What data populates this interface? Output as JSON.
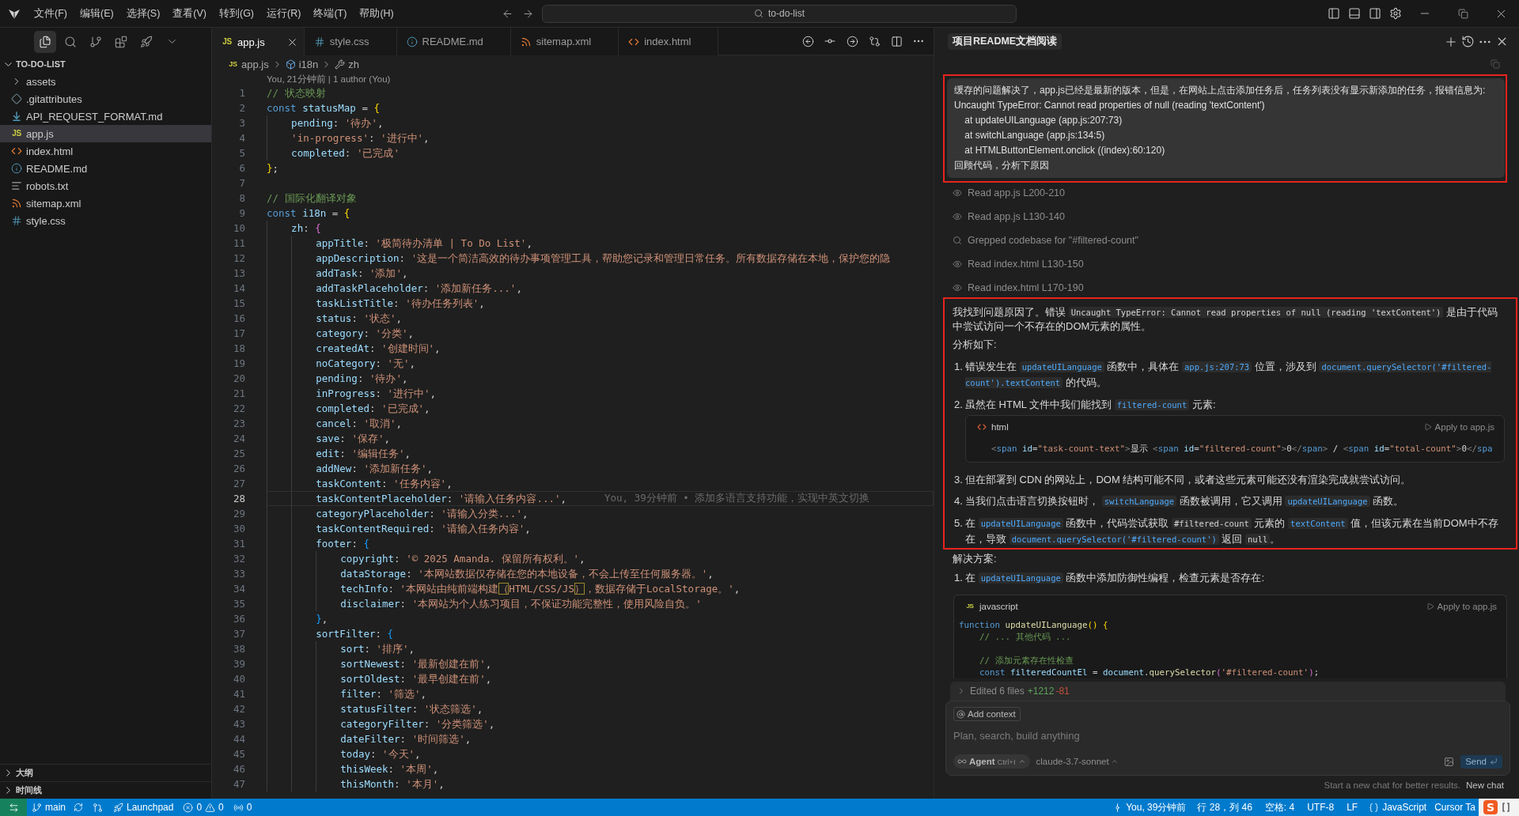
{
  "title_bar": {
    "menus": [
      "文件(F)",
      "编辑(E)",
      "选择(S)",
      "查看(V)",
      "转到(G)",
      "运行(R)",
      "终端(T)",
      "帮助(H)"
    ],
    "search": "to-do-list"
  },
  "sidebar": {
    "toolbar": [
      {
        "selected": true
      },
      {
        "selected": false
      },
      {
        "selected": false
      },
      {
        "selected": false
      },
      {
        "selected": false
      }
    ],
    "explorer": {
      "title": "TO-DO-LIST",
      "expanded": true,
      "items": [
        {
          "name": "assets",
          "kind": "folder",
          "expanded": false,
          "selected": false
        },
        {
          "name": ".gitattributes",
          "kind": "gitattributes",
          "selected": false
        },
        {
          "name": "API_REQUEST_FORMAT.md",
          "kind": "markdown",
          "selected": false
        },
        {
          "name": "app.js",
          "kind": "javascript",
          "icon_label": "JS",
          "selected": true
        },
        {
          "name": "index.html",
          "kind": "html",
          "selected": false
        },
        {
          "name": "README.md",
          "kind": "readme",
          "selected": false
        },
        {
          "name": "robots.txt",
          "kind": "text",
          "selected": false
        },
        {
          "name": "sitemap.xml",
          "kind": "xml",
          "selected": false
        },
        {
          "name": "style.css",
          "kind": "css",
          "selected": false
        }
      ]
    },
    "sections": [
      {
        "title": "大纲",
        "expanded": false
      },
      {
        "title": "时间线",
        "expanded": false
      }
    ]
  },
  "editor": {
    "tabs": [
      {
        "label": "app.js",
        "kind": "javascript",
        "icon_label": "JS",
        "selected": true
      },
      {
        "label": "style.css",
        "kind": "css",
        "selected": false
      },
      {
        "label": "README.md",
        "kind": "readme",
        "selected": false
      },
      {
        "label": "sitemap.xml",
        "kind": "xml",
        "selected": false
      },
      {
        "label": "index.html",
        "kind": "html",
        "selected": false
      }
    ],
    "breadcrumbs": [
      {
        "label": "app.js",
        "kind": "javascript",
        "icon_label": "JS"
      },
      {
        "label": "i18n",
        "kind": "variable"
      },
      {
        "label": "zh",
        "kind": "property"
      }
    ],
    "codelens": "You, 21分钟前 | 1 author (You)",
    "lines": [
      {
        "number": "1",
        "current": false,
        "tokens": [
          {
            "text": "// 状态映射",
            "kind": "comment"
          }
        ]
      },
      {
        "number": "2",
        "current": false,
        "tokens": [
          {
            "text": "const ",
            "kind": "keyword"
          },
          {
            "text": "statusMap",
            "kind": "variable"
          },
          {
            "text": " = ",
            "kind": "punct"
          },
          {
            "text": "{",
            "kind": "bracket1"
          }
        ]
      },
      {
        "number": "3",
        "current": false,
        "tokens": [
          {
            "text": "    pending",
            "kind": "property"
          },
          {
            "text": ": ",
            "kind": "punct"
          },
          {
            "text": "'待办'",
            "kind": "string"
          },
          {
            "text": ",",
            "kind": "punct"
          }
        ]
      },
      {
        "number": "4",
        "current": false,
        "tokens": [
          {
            "text": "    'in-progress'",
            "kind": "string"
          },
          {
            "text": ": ",
            "kind": "punct"
          },
          {
            "text": "'进行中'",
            "kind": "string"
          },
          {
            "text": ",",
            "kind": "punct"
          }
        ]
      },
      {
        "number": "5",
        "current": false,
        "tokens": [
          {
            "text": "    completed",
            "kind": "property"
          },
          {
            "text": ": ",
            "kind": "punct"
          },
          {
            "text": "'已完成'",
            "kind": "string"
          }
        ]
      },
      {
        "number": "6",
        "current": false,
        "tokens": [
          {
            "text": "}",
            "kind": "bracket1"
          },
          {
            "text": ";",
            "kind": "punct"
          }
        ]
      },
      {
        "number": "7",
        "current": false
      },
      {
        "number": "8",
        "current": false,
        "tokens": [
          {
            "text": "// 国际化翻译对象",
            "kind": "comment"
          }
        ]
      },
      {
        "number": "9",
        "current": false,
        "tokens": [
          {
            "text": "const ",
            "kind": "keyword"
          },
          {
            "text": "i18n",
            "kind": "variable"
          },
          {
            "text": " = ",
            "kind": "punct"
          },
          {
            "text": "{",
            "kind": "bracket1"
          }
        ]
      },
      {
        "number": "10",
        "current": false,
        "tokens": [
          {
            "text": "    zh",
            "kind": "property"
          },
          {
            "text": ": ",
            "kind": "punct"
          },
          {
            "text": "{",
            "kind": "bracket2"
          }
        ]
      },
      {
        "number": "11",
        "current": false,
        "tokens": [
          {
            "text": "        appTitle",
            "kind": "property"
          },
          {
            "text": ": ",
            "kind": "punct"
          },
          {
            "text": "'极简待办清单 | To Do List'",
            "kind": "string"
          },
          {
            "text": ",",
            "kind": "punct"
          }
        ]
      },
      {
        "number": "12",
        "current": false,
        "tokens": [
          {
            "text": "        appDescription",
            "kind": "property"
          },
          {
            "text": ": ",
            "kind": "punct"
          },
          {
            "text": "'这是一个简洁高效的待办事项管理工具，帮助您记录和管理日常任务。所有数据存储在本地，保护您的隐",
            "kind": "string"
          }
        ]
      },
      {
        "number": "13",
        "current": false,
        "tokens": [
          {
            "text": "        addTask",
            "kind": "property"
          },
          {
            "text": ": ",
            "kind": "punct"
          },
          {
            "text": "'添加'",
            "kind": "string"
          },
          {
            "text": ",",
            "kind": "punct"
          }
        ]
      },
      {
        "number": "14",
        "current": false,
        "tokens": [
          {
            "text": "        addTaskPlaceholder",
            "kind": "property"
          },
          {
            "text": ": ",
            "kind": "punct"
          },
          {
            "text": "'添加新任务...'",
            "kind": "string"
          },
          {
            "text": ",",
            "kind": "punct"
          }
        ]
      },
      {
        "number": "15",
        "current": false,
        "tokens": [
          {
            "text": "        taskListTitle",
            "kind": "property"
          },
          {
            "text": ": ",
            "kind": "punct"
          },
          {
            "text": "'待办任务列表'",
            "kind": "string"
          },
          {
            "text": ",",
            "kind": "punct"
          }
        ]
      },
      {
        "number": "16",
        "current": false,
        "tokens": [
          {
            "text": "        status",
            "kind": "property"
          },
          {
            "text": ": ",
            "kind": "punct"
          },
          {
            "text": "'状态'",
            "kind": "string"
          },
          {
            "text": ",",
            "kind": "punct"
          }
        ]
      },
      {
        "number": "17",
        "current": false,
        "tokens": [
          {
            "text": "        category",
            "kind": "property"
          },
          {
            "text": ": ",
            "kind": "punct"
          },
          {
            "text": "'分类'",
            "kind": "string"
          },
          {
            "text": ",",
            "kind": "punct"
          }
        ]
      },
      {
        "number": "18",
        "current": false,
        "tokens": [
          {
            "text": "        createdAt",
            "kind": "property"
          },
          {
            "text": ": ",
            "kind": "punct"
          },
          {
            "text": "'创建时间'",
            "kind": "string"
          },
          {
            "text": ",",
            "kind": "punct"
          }
        ]
      },
      {
        "number": "19",
        "current": false,
        "tokens": [
          {
            "text": "        noCategory",
            "kind": "property"
          },
          {
            "text": ": ",
            "kind": "punct"
          },
          {
            "text": "'无'",
            "kind": "string"
          },
          {
            "text": ",",
            "kind": "punct"
          }
        ]
      },
      {
        "number": "20",
        "current": false,
        "tokens": [
          {
            "text": "        pending",
            "kind": "property"
          },
          {
            "text": ": ",
            "kind": "punct"
          },
          {
            "text": "'待办'",
            "kind": "string"
          },
          {
            "text": ",",
            "kind": "punct"
          }
        ]
      },
      {
        "number": "21",
        "current": false,
        "tokens": [
          {
            "text": "        inProgress",
            "kind": "property"
          },
          {
            "text": ": ",
            "kind": "punct"
          },
          {
            "text": "'进行中'",
            "kind": "string"
          },
          {
            "text": ",",
            "kind": "punct"
          }
        ]
      },
      {
        "number": "22",
        "current": false,
        "tokens": [
          {
            "text": "        completed",
            "kind": "property"
          },
          {
            "text": ": ",
            "kind": "punct"
          },
          {
            "text": "'已完成'",
            "kind": "string"
          },
          {
            "text": ",",
            "kind": "punct"
          }
        ]
      },
      {
        "number": "23",
        "current": false,
        "tokens": [
          {
            "text": "        cancel",
            "kind": "property"
          },
          {
            "text": ": ",
            "kind": "punct"
          },
          {
            "text": "'取消'",
            "kind": "string"
          },
          {
            "text": ",",
            "kind": "punct"
          }
        ]
      },
      {
        "number": "24",
        "current": false,
        "tokens": [
          {
            "text": "        save",
            "kind": "property"
          },
          {
            "text": ": ",
            "kind": "punct"
          },
          {
            "text": "'保存'",
            "kind": "string"
          },
          {
            "text": ",",
            "kind": "punct"
          }
        ]
      },
      {
        "number": "25",
        "current": false,
        "tokens": [
          {
            "text": "        edit",
            "kind": "property"
          },
          {
            "text": ": ",
            "kind": "punct"
          },
          {
            "text": "'编辑任务'",
            "kind": "string"
          },
          {
            "text": ",",
            "kind": "punct"
          }
        ]
      },
      {
        "number": "26",
        "current": false,
        "tokens": [
          {
            "text": "        addNew",
            "kind": "property"
          },
          {
            "text": ": ",
            "kind": "punct"
          },
          {
            "text": "'添加新任务'",
            "kind": "string"
          },
          {
            "text": ",",
            "kind": "punct"
          }
        ]
      },
      {
        "number": "27",
        "current": false,
        "tokens": [
          {
            "text": "        taskContent",
            "kind": "property"
          },
          {
            "text": ": ",
            "kind": "punct"
          },
          {
            "text": "'任务内容'",
            "kind": "string"
          },
          {
            "text": ",",
            "kind": "punct"
          }
        ]
      },
      {
        "number": "28",
        "current": true,
        "blame": "You, 39分钟前 • 添加多语言支持功能，实现中英文切换",
        "tokens": [
          {
            "text": "        taskContentPlaceholder",
            "kind": "property"
          },
          {
            "text": ": ",
            "kind": "punct"
          },
          {
            "text": "'请输入任务内容...'",
            "kind": "string"
          },
          {
            "text": ",",
            "kind": "punct"
          }
        ]
      },
      {
        "number": "29",
        "current": false,
        "tokens": [
          {
            "text": "        categoryPlaceholder",
            "kind": "property"
          },
          {
            "text": ": ",
            "kind": "punct"
          },
          {
            "text": "'请输入分类...'",
            "kind": "string"
          },
          {
            "text": ",",
            "kind": "punct"
          }
        ]
      },
      {
        "number": "30",
        "current": false,
        "tokens": [
          {
            "text": "        taskContentRequired",
            "kind": "property"
          },
          {
            "text": ": ",
            "kind": "punct"
          },
          {
            "text": "'请输入任务内容'",
            "kind": "string"
          },
          {
            "text": ",",
            "kind": "punct"
          }
        ]
      },
      {
        "number": "31",
        "current": false,
        "tokens": [
          {
            "text": "        footer",
            "kind": "property"
          },
          {
            "text": ": ",
            "kind": "punct"
          },
          {
            "text": "{",
            "kind": "bracket3"
          }
        ]
      },
      {
        "number": "32",
        "current": false,
        "tokens": [
          {
            "text": "            copyright",
            "kind": "property"
          },
          {
            "text": ": ",
            "kind": "punct"
          },
          {
            "text": "'© 2025 Amanda. 保留所有权利。'",
            "kind": "string"
          },
          {
            "text": ",",
            "kind": "punct"
          }
        ]
      },
      {
        "number": "33",
        "current": false,
        "tokens": [
          {
            "text": "            dataStorage",
            "kind": "property"
          },
          {
            "text": ": ",
            "kind": "punct"
          },
          {
            "text": "'本网站数据仅存储在您的本地设备，不会上传至任何服务器。'",
            "kind": "string"
          },
          {
            "text": ",",
            "kind": "punct"
          }
        ]
      },
      {
        "number": "34",
        "current": false,
        "tokens": [
          {
            "text": "            techInfo",
            "kind": "property"
          },
          {
            "text": ": ",
            "kind": "punct"
          },
          {
            "text": "'本网站由纯前端构建",
            "kind": "string"
          },
          {
            "text": "（",
            "kind": "match"
          },
          {
            "text": "HTML/CSS/JS",
            "kind": "string"
          },
          {
            "text": "）",
            "kind": "match"
          },
          {
            "text": "，数据存储于LocalStorage。'",
            "kind": "string"
          },
          {
            "text": ",",
            "kind": "punct"
          }
        ]
      },
      {
        "number": "35",
        "current": false,
        "tokens": [
          {
            "text": "            disclaimer",
            "kind": "property"
          },
          {
            "text": ": ",
            "kind": "punct"
          },
          {
            "text": "'本网站为个人练习项目，不保证功能完整性，使用风险自负。'",
            "kind": "string"
          }
        ]
      },
      {
        "number": "36",
        "current": false,
        "tokens": [
          {
            "text": "        }",
            "kind": "bracket3"
          },
          {
            "text": ",",
            "kind": "punct"
          }
        ]
      },
      {
        "number": "37",
        "current": false,
        "tokens": [
          {
            "text": "        sortFilter",
            "kind": "property"
          },
          {
            "text": ": ",
            "kind": "punct"
          },
          {
            "text": "{",
            "kind": "bracket3"
          }
        ]
      },
      {
        "number": "38",
        "current": false,
        "tokens": [
          {
            "text": "            sort",
            "kind": "property"
          },
          {
            "text": ": ",
            "kind": "punct"
          },
          {
            "text": "'排序'",
            "kind": "string"
          },
          {
            "text": ",",
            "kind": "punct"
          }
        ]
      },
      {
        "number": "39",
        "current": false,
        "tokens": [
          {
            "text": "            sortNewest",
            "kind": "property"
          },
          {
            "text": ": ",
            "kind": "punct"
          },
          {
            "text": "'最新创建在前'",
            "kind": "string"
          },
          {
            "text": ",",
            "kind": "punct"
          }
        ]
      },
      {
        "number": "40",
        "current": false,
        "tokens": [
          {
            "text": "            sortOldest",
            "kind": "property"
          },
          {
            "text": ": ",
            "kind": "punct"
          },
          {
            "text": "'最早创建在前'",
            "kind": "string"
          },
          {
            "text": ",",
            "kind": "punct"
          }
        ]
      },
      {
        "number": "41",
        "current": false,
        "tokens": [
          {
            "text": "            filter",
            "kind": "property"
          },
          {
            "text": ": ",
            "kind": "punct"
          },
          {
            "text": "'筛选'",
            "kind": "string"
          },
          {
            "text": ",",
            "kind": "punct"
          }
        ]
      },
      {
        "number": "42",
        "current": false,
        "tokens": [
          {
            "text": "            statusFilter",
            "kind": "property"
          },
          {
            "text": ": ",
            "kind": "punct"
          },
          {
            "text": "'状态筛选'",
            "kind": "string"
          },
          {
            "text": ",",
            "kind": "punct"
          }
        ]
      },
      {
        "number": "43",
        "current": false,
        "tokens": [
          {
            "text": "            categoryFilter",
            "kind": "property"
          },
          {
            "text": ": ",
            "kind": "punct"
          },
          {
            "text": "'分类筛选'",
            "kind": "string"
          },
          {
            "text": ",",
            "kind": "punct"
          }
        ]
      },
      {
        "number": "44",
        "current": false,
        "tokens": [
          {
            "text": "            dateFilter",
            "kind": "property"
          },
          {
            "text": ": ",
            "kind": "punct"
          },
          {
            "text": "'时间筛选'",
            "kind": "string"
          },
          {
            "text": ",",
            "kind": "punct"
          }
        ]
      },
      {
        "number": "45",
        "current": false,
        "tokens": [
          {
            "text": "            today",
            "kind": "property"
          },
          {
            "text": ": ",
            "kind": "punct"
          },
          {
            "text": "'今天'",
            "kind": "string"
          },
          {
            "text": ",",
            "kind": "punct"
          }
        ]
      },
      {
        "number": "46",
        "current": false,
        "tokens": [
          {
            "text": "            thisWeek",
            "kind": "property"
          },
          {
            "text": ": ",
            "kind": "punct"
          },
          {
            "text": "'本周'",
            "kind": "string"
          },
          {
            "text": ",",
            "kind": "punct"
          }
        ]
      },
      {
        "number": "47",
        "current": false,
        "tokens": [
          {
            "text": "            thisMonth",
            "kind": "property"
          },
          {
            "text": ": ",
            "kind": "punct"
          },
          {
            "text": "'本月'",
            "kind": "string"
          },
          {
            "text": ",",
            "kind": "punct"
          }
        ]
      }
    ]
  },
  "chat": {
    "title": "项目README文档阅读",
    "user_message": {
      "highlighted": true,
      "lines": [
        "缓存的问题解决了，app.js已经是最新的版本，但是，在网站上点击添加任务后，任务列表没有显示新添加的任务，报错信息为:",
        "Uncaught TypeError: Cannot read properties of null (reading 'textContent')",
        "    at updateUILanguage (app.js:207:73)",
        "    at switchLanguage (app.js:134:5)",
        "    at HTMLButtonElement.onclick ((index):60:120)",
        "回顾代码，分析下原因"
      ]
    },
    "steps": [
      {
        "kind": "read",
        "text": "Read app.js L200-210"
      },
      {
        "kind": "read",
        "text": "Read app.js L130-140"
      },
      {
        "kind": "grep",
        "text": "Grepped codebase for \"#filtered-count\""
      },
      {
        "kind": "read",
        "text": "Read index.html L130-150"
      },
      {
        "kind": "read",
        "text": "Read index.html L170-190"
      }
    ],
    "answer": {
      "highlighted": true,
      "intro": [
        {
          "text": "我找到问题原因了。错误 ",
          "kind": "text"
        },
        {
          "text": "Uncaught TypeError: Cannot read properties of null (reading 'textContent')",
          "kind": "code"
        },
        {
          "text": " 是由于代码中尝试访问一个不存在的DOM元素的属性。",
          "kind": "text"
        }
      ],
      "heading": "分析如下:",
      "items": [
        {
          "number": "1.",
          "segments": [
            {
              "text": "错误发生在 ",
              "kind": "text"
            },
            {
              "text": "updateUILanguage",
              "kind": "symbol"
            },
            {
              "text": " 函数中，具体在 ",
              "kind": "text"
            },
            {
              "text": "app.js:207:73",
              "kind": "symbol"
            },
            {
              "text": " 位置，涉及到 ",
              "kind": "text"
            },
            {
              "text": "document.querySelector('#filtered-count').textContent",
              "kind": "symbol"
            },
            {
              "text": " 的代码。",
              "kind": "text"
            }
          ]
        },
        {
          "number": "2.",
          "segments": [
            {
              "text": "虽然在 HTML 文件中我们能找到 ",
              "kind": "text"
            },
            {
              "text": "filtered-count",
              "kind": "symbol"
            },
            {
              "text": " 元素:",
              "kind": "text"
            }
          ],
          "code_block": {
            "kind": "html",
            "language": "html",
            "apply": "Apply to app.js",
            "groups": [
              {
                "lines": [
                  {
                    "tokens": [
                      {
                        "text": "    <",
                        "kind": "tag-bracket"
                      },
                      {
                        "text": "span",
                        "kind": "tag"
                      },
                      {
                        "text": " id",
                        "kind": "attr"
                      },
                      {
                        "text": "=",
                        "kind": "punct"
                      },
                      {
                        "text": "\"task-count-text\"",
                        "kind": "string"
                      },
                      {
                        "text": ">",
                        "kind": "tag-bracket"
                      },
                      {
                        "text": "显示 ",
                        "kind": "text"
                      },
                      {
                        "text": "<",
                        "kind": "tag-bracket"
                      },
                      {
                        "text": "span",
                        "kind": "tag"
                      },
                      {
                        "text": " id",
                        "kind": "attr"
                      },
                      {
                        "text": "=",
                        "kind": "punct"
                      },
                      {
                        "text": "\"filtered-count\"",
                        "kind": "string"
                      },
                      {
                        "text": ">",
                        "kind": "tag-bracket"
                      },
                      {
                        "text": "0",
                        "kind": "text"
                      },
                      {
                        "text": "</",
                        "kind": "tag-bracket"
                      },
                      {
                        "text": "span",
                        "kind": "tag"
                      },
                      {
                        "text": ">",
                        "kind": "tag-bracket"
                      },
                      {
                        "text": " / ",
                        "kind": "text"
                      },
                      {
                        "text": "<",
                        "kind": "tag-bracket"
                      },
                      {
                        "text": "span",
                        "kind": "tag"
                      },
                      {
                        "text": " id",
                        "kind": "attr"
                      },
                      {
                        "text": "=",
                        "kind": "punct"
                      },
                      {
                        "text": "\"total-count\"",
                        "kind": "string"
                      },
                      {
                        "text": ">",
                        "kind": "tag-bracket"
                      },
                      {
                        "text": "0",
                        "kind": "text"
                      },
                      {
                        "text": "</",
                        "kind": "tag-bracket"
                      },
                      {
                        "text": "spa",
                        "kind": "tag"
                      }
                    ]
                  }
                ]
              }
            ]
          }
        },
        {
          "number": "3.",
          "segments": [
            {
              "text": "但在部署到 CDN 的网站上，DOM 结构可能不同，或者这些元素可能还没有渲染完成就尝试访问。",
              "kind": "text"
            }
          ]
        },
        {
          "number": "4.",
          "segments": [
            {
              "text": "当我们点击语言切换按钮时， ",
              "kind": "text"
            },
            {
              "text": "switchLanguage",
              "kind": "symbol"
            },
            {
              "text": " 函数被调用，它又调用 ",
              "kind": "text"
            },
            {
              "text": "updateUILanguage",
              "kind": "symbol"
            },
            {
              "text": " 函数。",
              "kind": "text"
            }
          ]
        },
        {
          "number": "5.",
          "segments": [
            {
              "text": "在 ",
              "kind": "text"
            },
            {
              "text": "updateUILanguage",
              "kind": "symbol"
            },
            {
              "text": " 函数中，代码尝试获取 ",
              "kind": "text"
            },
            {
              "text": "#filtered-count",
              "kind": "code"
            },
            {
              "text": " 元素的 ",
              "kind": "text"
            },
            {
              "text": "textContent",
              "kind": "symbol"
            },
            {
              "text": " 值，但该元素在当前DOM中不存在，导致 ",
              "kind": "text"
            },
            {
              "text": "document.querySelector('#filtered-count')",
              "kind": "symbol"
            },
            {
              "text": " 返回 ",
              "kind": "text"
            },
            {
              "text": "null",
              "kind": "code"
            },
            {
              "text": "。",
              "kind": "text"
            }
          ]
        }
      ]
    },
    "solution": {
      "heading": "解决方案:",
      "items": [
        {
          "number": "1.",
          "segments": [
            {
              "text": "在 ",
              "kind": "text"
            },
            {
              "text": "updateUILanguage",
              "kind": "symbol"
            },
            {
              "text": " 函数中添加防御性编程，检查元素是否存在:",
              "kind": "text"
            }
          ],
          "code_block": {
            "kind": "javascript",
            "icon_label": "JS",
            "language": "javascript",
            "apply": "Apply to app.js",
            "groups": [
              {
                "lines": [
                  {
                    "tokens": [
                      {
                        "text": "function",
                        "kind": "keyword"
                      },
                      {
                        "text": " updateUILanguage",
                        "kind": "function"
                      },
                      {
                        "text": "()",
                        "kind": "bracket1"
                      },
                      {
                        "text": " {",
                        "kind": "bracket1"
                      }
                    ]
                  },
                  {
                    "tokens": [
                      {
                        "text": "    // ... 其他代码 ...",
                        "kind": "comment"
                      }
                    ]
                  }
                ]
              },
              {
                "lines": [
                  {
                    "tokens": [
                      {
                        "text": "    // 添加元素存在性检查",
                        "kind": "comment"
                      }
                    ]
                  },
                  {
                    "tokens": [
                      {
                        "text": "    const",
                        "kind": "keyword"
                      },
                      {
                        "text": " filteredCountEl",
                        "kind": "variable"
                      },
                      {
                        "text": " = ",
                        "kind": "punct"
                      },
                      {
                        "text": "document",
                        "kind": "property"
                      },
                      {
                        "text": ".",
                        "kind": "punct"
                      },
                      {
                        "text": "querySelector",
                        "kind": "function"
                      },
                      {
                        "text": "(",
                        "kind": "bracket2"
                      },
                      {
                        "text": "'#filtered-count'",
                        "kind": "string"
                      },
                      {
                        "text": ")",
                        "kind": "bracket2"
                      },
                      {
                        "text": ";",
                        "kind": "punct"
                      }
                    ]
                  }
                ]
              }
            ]
          }
        }
      ]
    },
    "edited": {
      "label": "Edited 6 files",
      "added": "+1212",
      "removed": "-81",
      "expanded": false
    },
    "composer": {
      "context_button": "Add context",
      "placeholder": "Plan, search, build anything",
      "mode": "Agent",
      "mode_shortcut": "Ctrl+I",
      "model": "claude-3.7-sonnet",
      "send": "Send"
    },
    "hint": {
      "text": "Start a new chat for better results.",
      "link": "New chat"
    }
  },
  "status_bar": {
    "branch": "main",
    "launchpad": "Launchpad",
    "errors": "0",
    "warnings": "0",
    "ports": "0",
    "blame": "You, 39分钟前",
    "position": "行 28，列 46",
    "indent": "空格: 4",
    "encoding": "UTF-8",
    "eol": "LF",
    "language": "JavaScript",
    "cursor_tab": "Cursor Ta",
    "ime": "S"
  }
}
